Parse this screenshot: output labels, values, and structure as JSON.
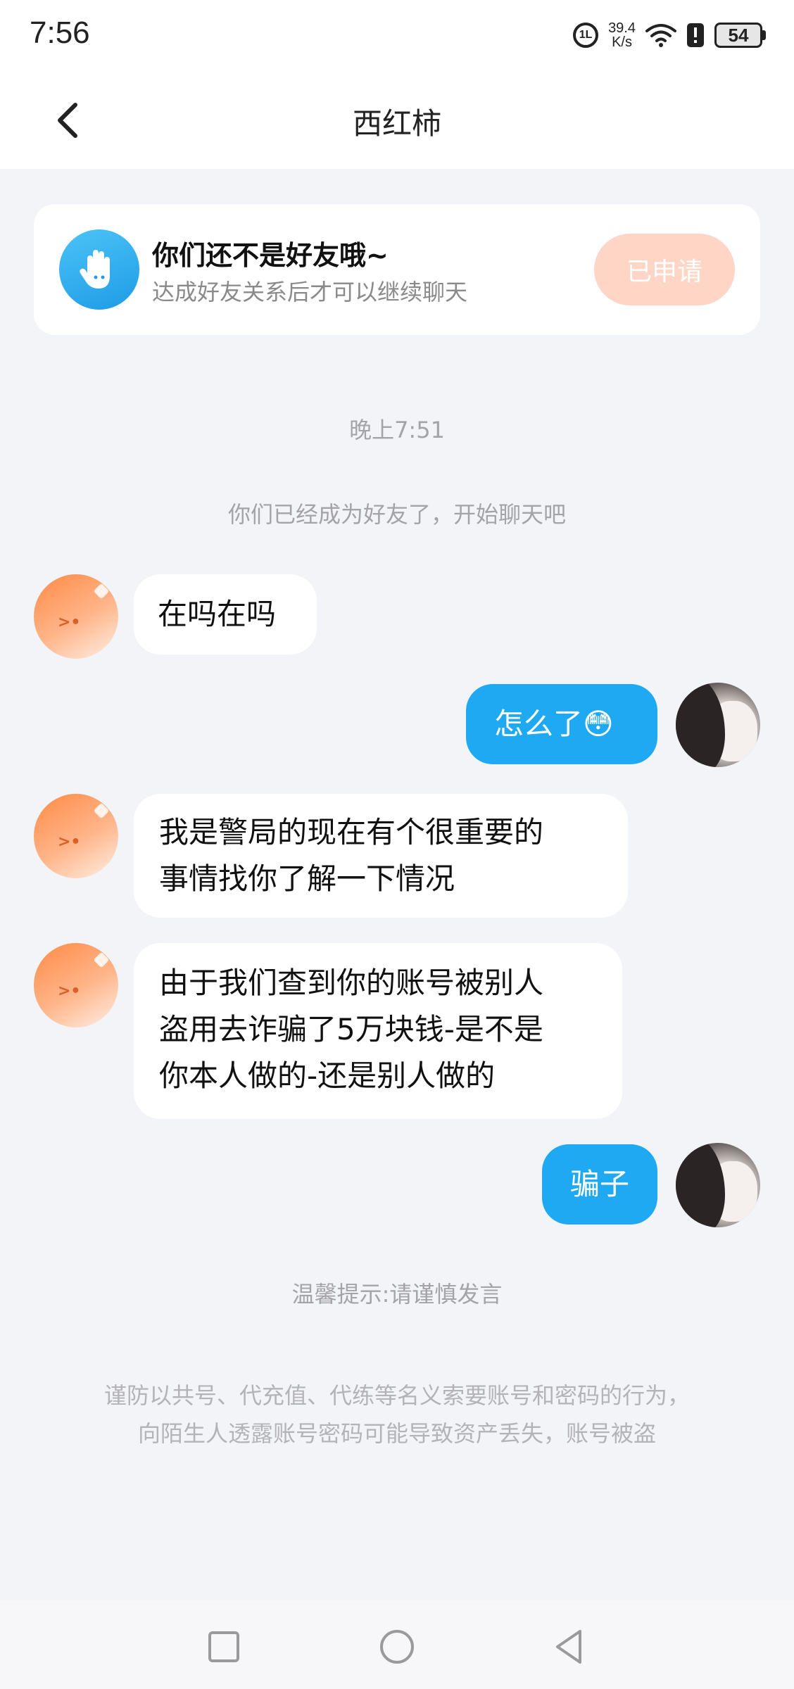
{
  "status_bar": {
    "time": "7:56",
    "hd_label": "1L",
    "speed_value": "39.4",
    "speed_unit": "K/s",
    "battery": "54"
  },
  "header": {
    "title": "西红柿"
  },
  "friend_card": {
    "title": "你们还不是好友哦~",
    "subtitle": "达成好友关系后才可以继续聊天",
    "button_label": "已申请"
  },
  "system": {
    "timestamp": "晚上7:51",
    "friend_notice": "你们已经成为好友了，开始聊天吧",
    "tip": "温馨提示:请谨慎发言",
    "warning_line1": "谨防以共号、代充值、代练等名义索要账号和密码的行为，",
    "warning_line2": "向陌生人透露账号密码可能导致资产丢失，账号被盗"
  },
  "messages": [
    {
      "side": "left",
      "lines": [
        "在吗在吗"
      ]
    },
    {
      "side": "right",
      "lines": [
        "怎么了😳"
      ]
    },
    {
      "side": "left",
      "lines": [
        "我是警局的现在有个很重要的",
        "事情找你了解一下情况"
      ]
    },
    {
      "side": "left",
      "lines": [
        "由于我们查到你的账号被别人",
        "盗用去诈骗了5万块钱-是不是",
        "你本人做的-还是别人做的"
      ]
    },
    {
      "side": "right",
      "lines": [
        "骗子"
      ]
    }
  ],
  "colors": {
    "accent_blue": "#1fa9f2",
    "applied_button": "#ffd6c6",
    "page_background": "#f3f4f8"
  },
  "icons": {
    "back": "chevron-left-icon",
    "hand": "hand-wave-icon",
    "wifi": "wifi-icon",
    "alert": "alert-icon",
    "nav_recent": "square-icon",
    "nav_home": "circle-icon",
    "nav_back": "triangle-back-icon"
  }
}
